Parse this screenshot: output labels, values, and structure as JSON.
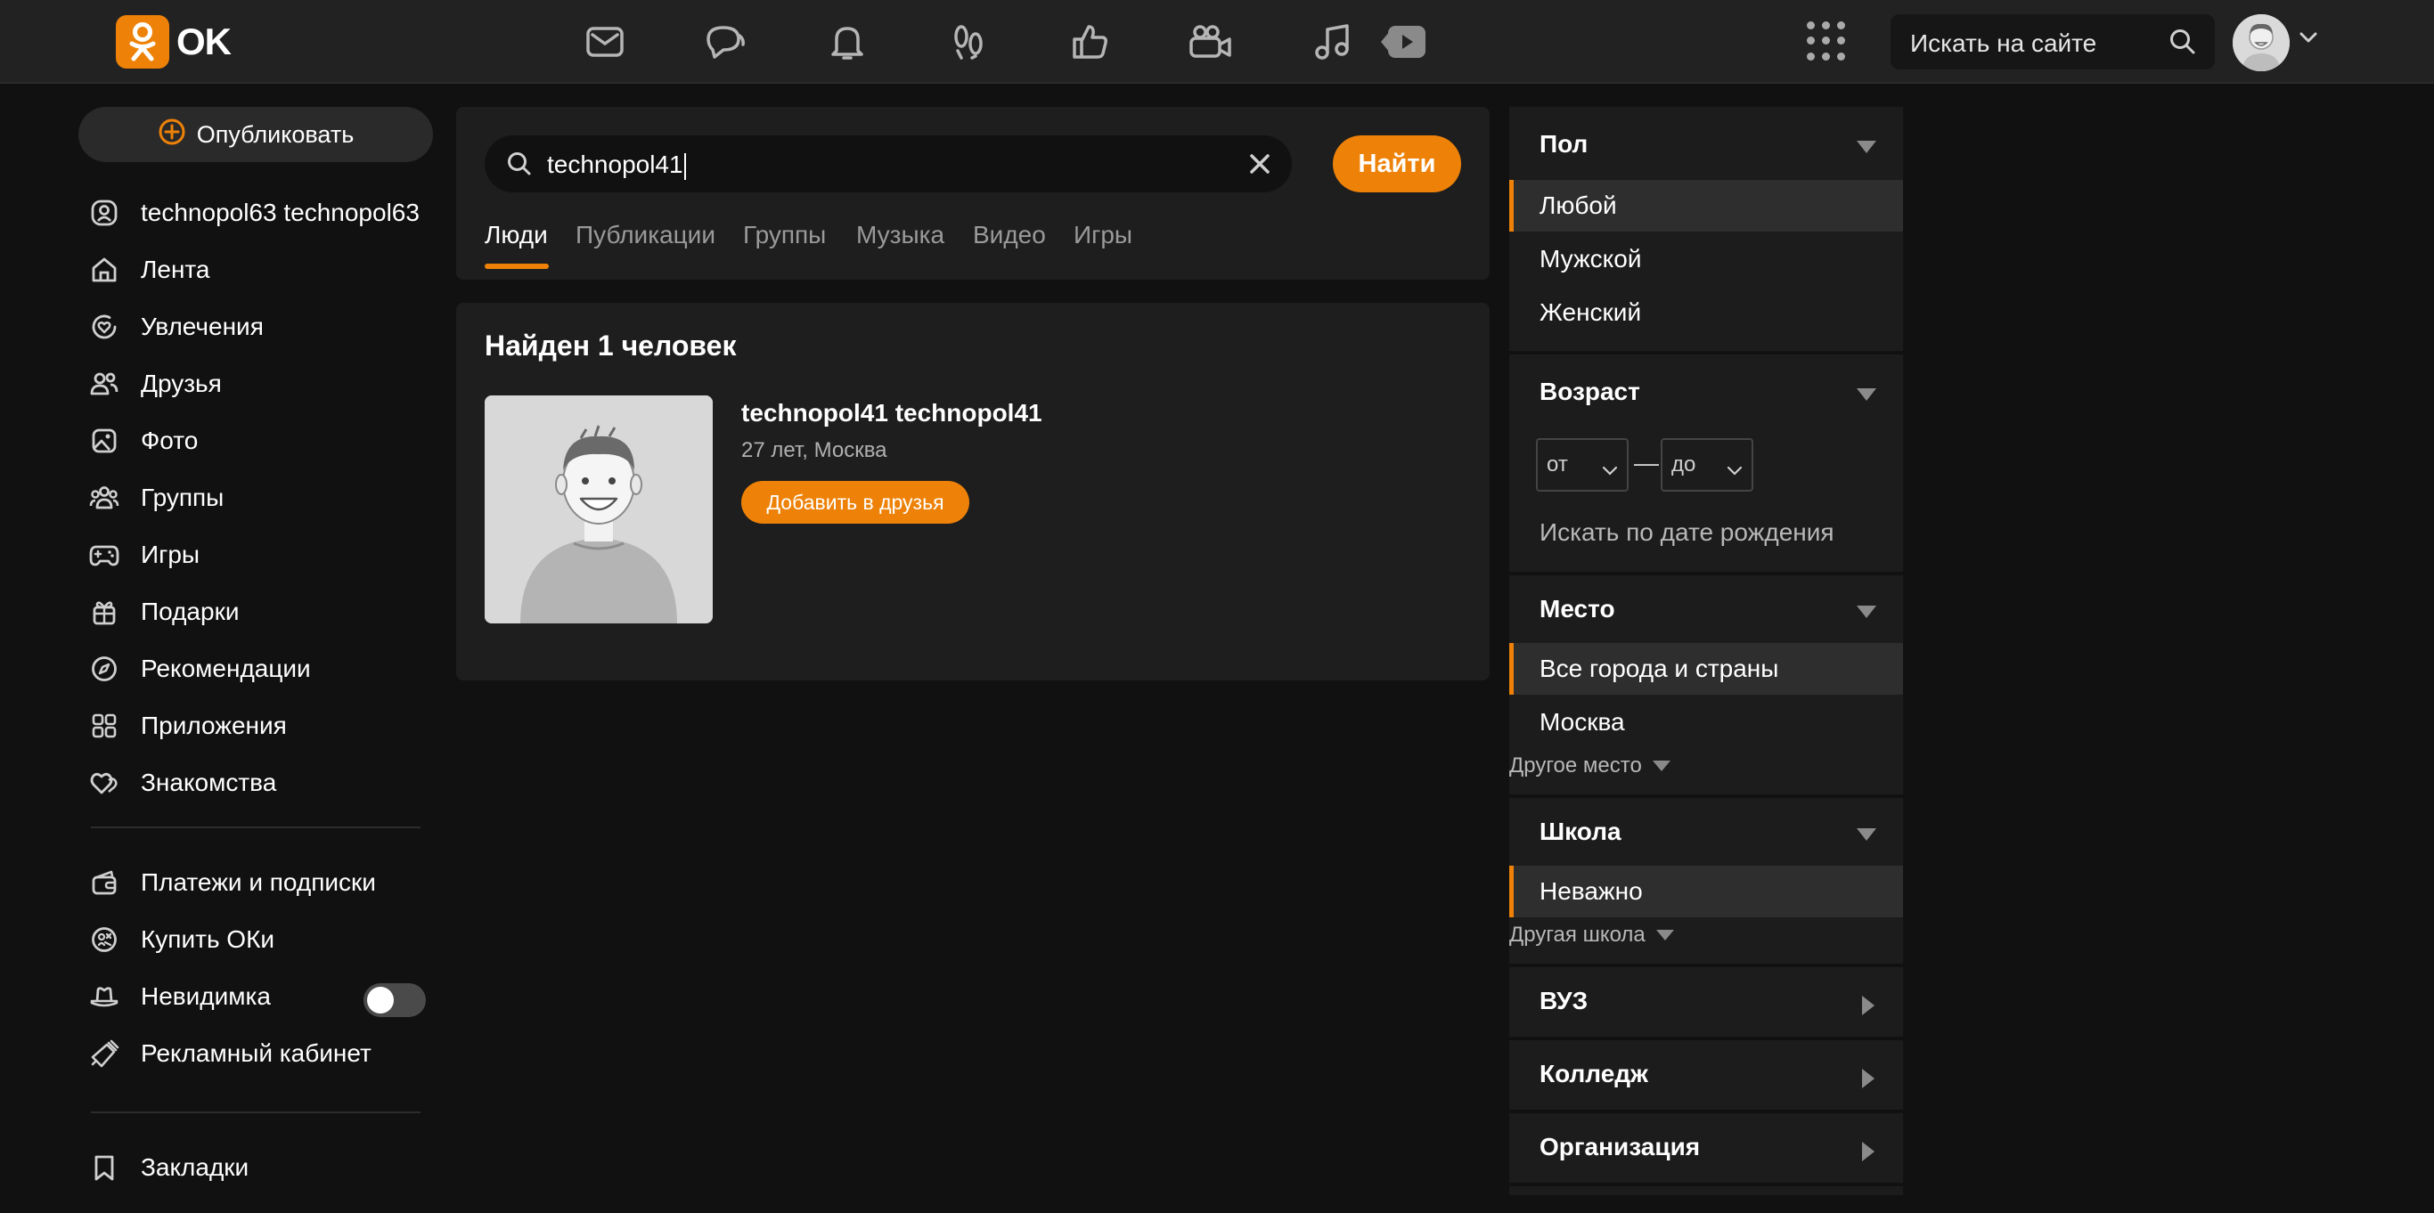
{
  "header": {
    "logo_text": "OK",
    "nav_icons": [
      "mail-icon",
      "chat-icon",
      "bell-icon",
      "footprints-icon",
      "thumbs-up-icon",
      "video-camera-icon",
      "music-note-icon",
      "video-play-icon"
    ],
    "site_search_placeholder": "Искать на сайте"
  },
  "sidebar": {
    "publish_label": "Опубликовать",
    "items": [
      {
        "label": "technopol63 technopol63",
        "icon": "user-icon"
      },
      {
        "label": "Лента",
        "icon": "home-icon"
      },
      {
        "label": "Увлечения",
        "icon": "heart-circle-icon"
      },
      {
        "label": "Друзья",
        "icon": "friends-icon"
      },
      {
        "label": "Фото",
        "icon": "photo-icon"
      },
      {
        "label": "Группы",
        "icon": "groups-icon"
      },
      {
        "label": "Игры",
        "icon": "gamepad-icon"
      },
      {
        "label": "Подарки",
        "icon": "gift-icon"
      },
      {
        "label": "Рекомендации",
        "icon": "compass-icon"
      },
      {
        "label": "Приложения",
        "icon": "apps-icon"
      },
      {
        "label": "Знакомства",
        "icon": "dating-hearts-icon"
      }
    ],
    "secondary_items": [
      {
        "label": "Платежи и подписки",
        "icon": "wallet-icon"
      },
      {
        "label": "Купить ОКи",
        "icon": "coin-icon"
      },
      {
        "label": "Невидимка",
        "icon": "hat-icon",
        "toggle_on": false
      },
      {
        "label": "Рекламный кабинет",
        "icon": "megaphone-icon"
      }
    ],
    "bookmarks_label": "Закладки"
  },
  "search": {
    "query": "technopol41",
    "find_label": "Найти",
    "tabs": [
      "Люди",
      "Публикации",
      "Группы",
      "Музыка",
      "Видео",
      "Игры"
    ],
    "active_tab": "Люди"
  },
  "results": {
    "title": "Найден 1 человек",
    "people": [
      {
        "name": "technopol41 technopol41",
        "info": "27 лет, Москва",
        "add_label": "Добавить в друзья"
      }
    ]
  },
  "filters": {
    "gender": {
      "title": "Пол",
      "options": [
        "Любой",
        "Мужской",
        "Женский"
      ],
      "selected": "Любой"
    },
    "age": {
      "title": "Возраст",
      "from": "от",
      "to": "до",
      "dash": "—",
      "birthdate_link": "Искать по дате рождения"
    },
    "place": {
      "title": "Место",
      "options": [
        "Все города и страны",
        "Москва"
      ],
      "selected": "Все города и страны",
      "more": "Другое место"
    },
    "school": {
      "title": "Школа",
      "options": [
        "Неважно"
      ],
      "selected": "Неважно",
      "more": "Другая школа"
    },
    "university": {
      "title": "ВУЗ"
    },
    "college": {
      "title": "Колледж"
    },
    "organization": {
      "title": "Организация"
    }
  },
  "colors": {
    "accent": "#ee8208",
    "background": "#111111",
    "panel": "#1e1e1e"
  }
}
